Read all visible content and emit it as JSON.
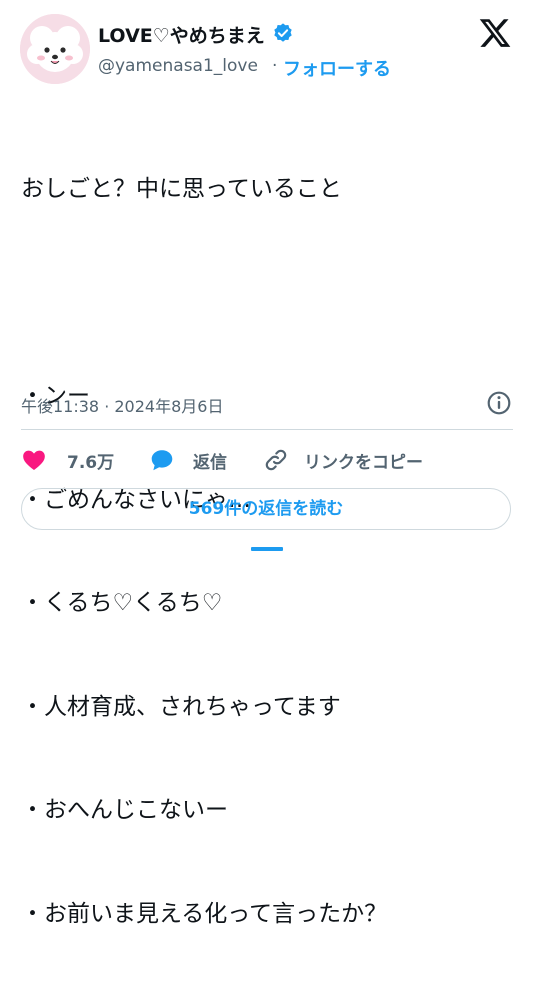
{
  "author": {
    "display_name": "LOVE♡やめちまえ",
    "handle": "@yamenasa1_love",
    "separator": "·",
    "follow_label": "フォローする",
    "avatar_icon": "white-fluffy-dog-avatar-icon",
    "verified_icon": "verified-badge-icon",
    "verified_color": "#1d9bf0"
  },
  "brand": {
    "logo_icon": "x-logo-icon"
  },
  "tweet": {
    "lines": [
      "おしごと？中に思っていること",
      "",
      "・ンー",
      "・ごめんなさいにゃ…",
      "・くるち♡くるち♡",
      "・人材育成、されちゃってます",
      "・おへんじこないー",
      "・お前いま見える化って言ったか？"
    ],
    "timestamp": "午後11:38 · 2024年8月6日",
    "info_icon": "info-icon"
  },
  "actions": {
    "like": {
      "icon": "heart-icon",
      "label": "7.6万",
      "color": "#f91880"
    },
    "reply": {
      "icon": "speech-bubble-icon",
      "label": "返信",
      "color": "#1d9bf0"
    },
    "copy_link": {
      "icon": "link-icon",
      "label": "リンクをコピー"
    }
  },
  "read_replies": {
    "label": "569件の返信を読む"
  },
  "colors": {
    "accent": "#1d9bf0",
    "secondary_text": "#536471",
    "border": "#cfd9de"
  }
}
